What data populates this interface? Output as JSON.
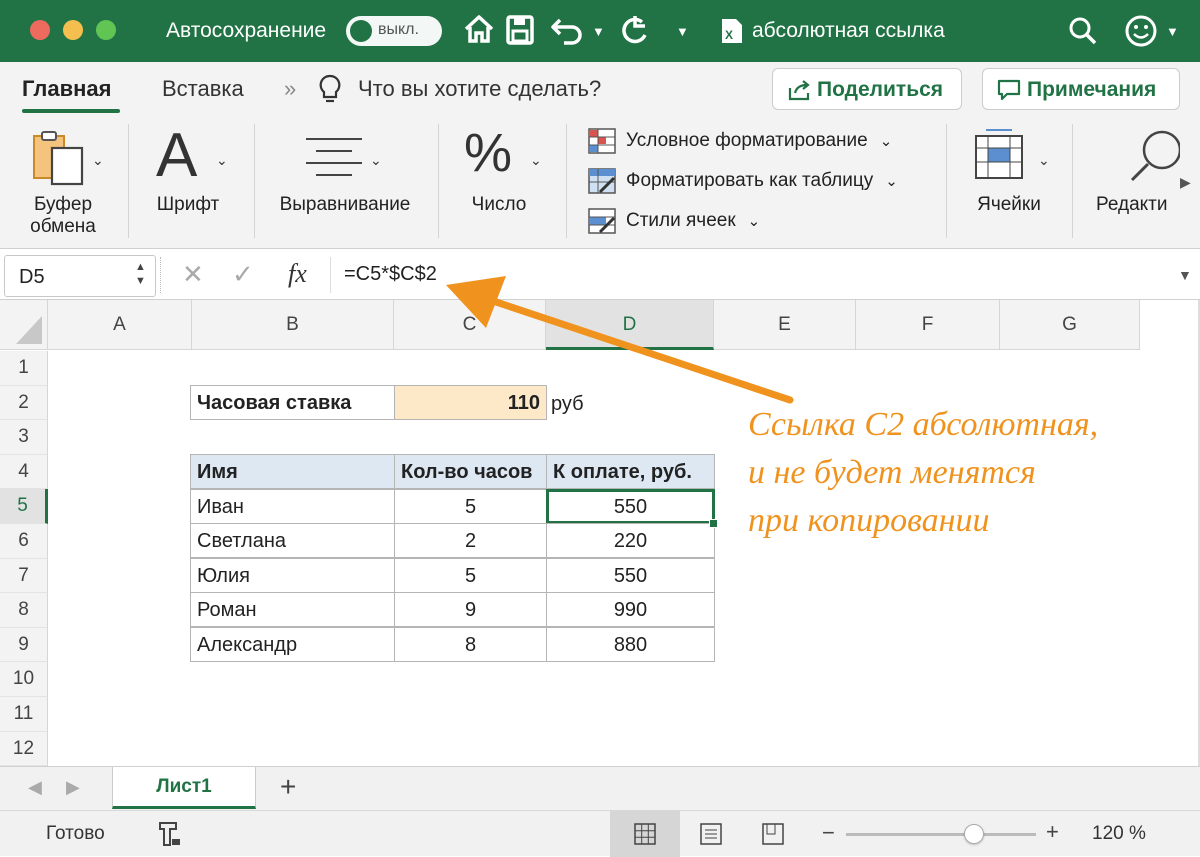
{
  "title_bar": {
    "autosave_label": "Автосохранение",
    "autosave_state": "выкл.",
    "document_name": "абсолютная ссылка",
    "colors": {
      "bar": "#217346",
      "close": "#ed6a5e",
      "minimize": "#f5bf4f",
      "zoom": "#61c554"
    }
  },
  "ribbon_tabs": {
    "home": "Главная",
    "insert": "Вставка",
    "more": "»",
    "tell_me": "Что вы хотите сделать?",
    "share_button": "Поделиться",
    "comments_button": "Примечания"
  },
  "ribbon": {
    "clipboard_line1": "Буфер",
    "clipboard_line2": "обмена",
    "font_glyph": "A",
    "font": "Шрифт",
    "alignment": "Выравнивание",
    "number_glyph": "%",
    "number": "Число",
    "conditional_formatting": "Условное форматирование",
    "format_as_table": "Форматировать как таблицу",
    "cell_styles": "Стили ячеек",
    "cells": "Ячейки",
    "editing": "Редакти"
  },
  "formula_bar": {
    "name_box": "D5",
    "fx": "fx",
    "formula": "=C5*$C$2"
  },
  "columns": [
    "A",
    "B",
    "C",
    "D",
    "E",
    "F",
    "G"
  ],
  "selected_column": "D",
  "rows": [
    "1",
    "2",
    "3",
    "4",
    "5",
    "6",
    "7",
    "8",
    "9",
    "10",
    "11",
    "12"
  ],
  "selected_row": "5",
  "sheet": {
    "rate_label": "Часовая ставка",
    "rate_value": "110",
    "rate_unit": "руб",
    "table_headers": [
      "Имя",
      "Кол-во часов",
      "К оплате, руб."
    ],
    "table_rows": [
      [
        "Иван",
        "5",
        "550"
      ],
      [
        "Светлана",
        "2",
        "220"
      ],
      [
        "Юлия",
        "5",
        "550"
      ],
      [
        "Роман",
        "9",
        "990"
      ],
      [
        "Александр",
        "8",
        "880"
      ]
    ]
  },
  "annotation": {
    "line1": "Ссылка С2 абсолютная,",
    "line2": "и не будет менятся",
    "line3": "при копировании",
    "color": "#f0931e"
  },
  "sheet_tabs": {
    "active": "Лист1",
    "add": "+"
  },
  "status_bar": {
    "status": "Готово",
    "zoom_minus": "−",
    "zoom_plus": "+",
    "zoom": "120 %",
    "zoom_level": 120
  }
}
